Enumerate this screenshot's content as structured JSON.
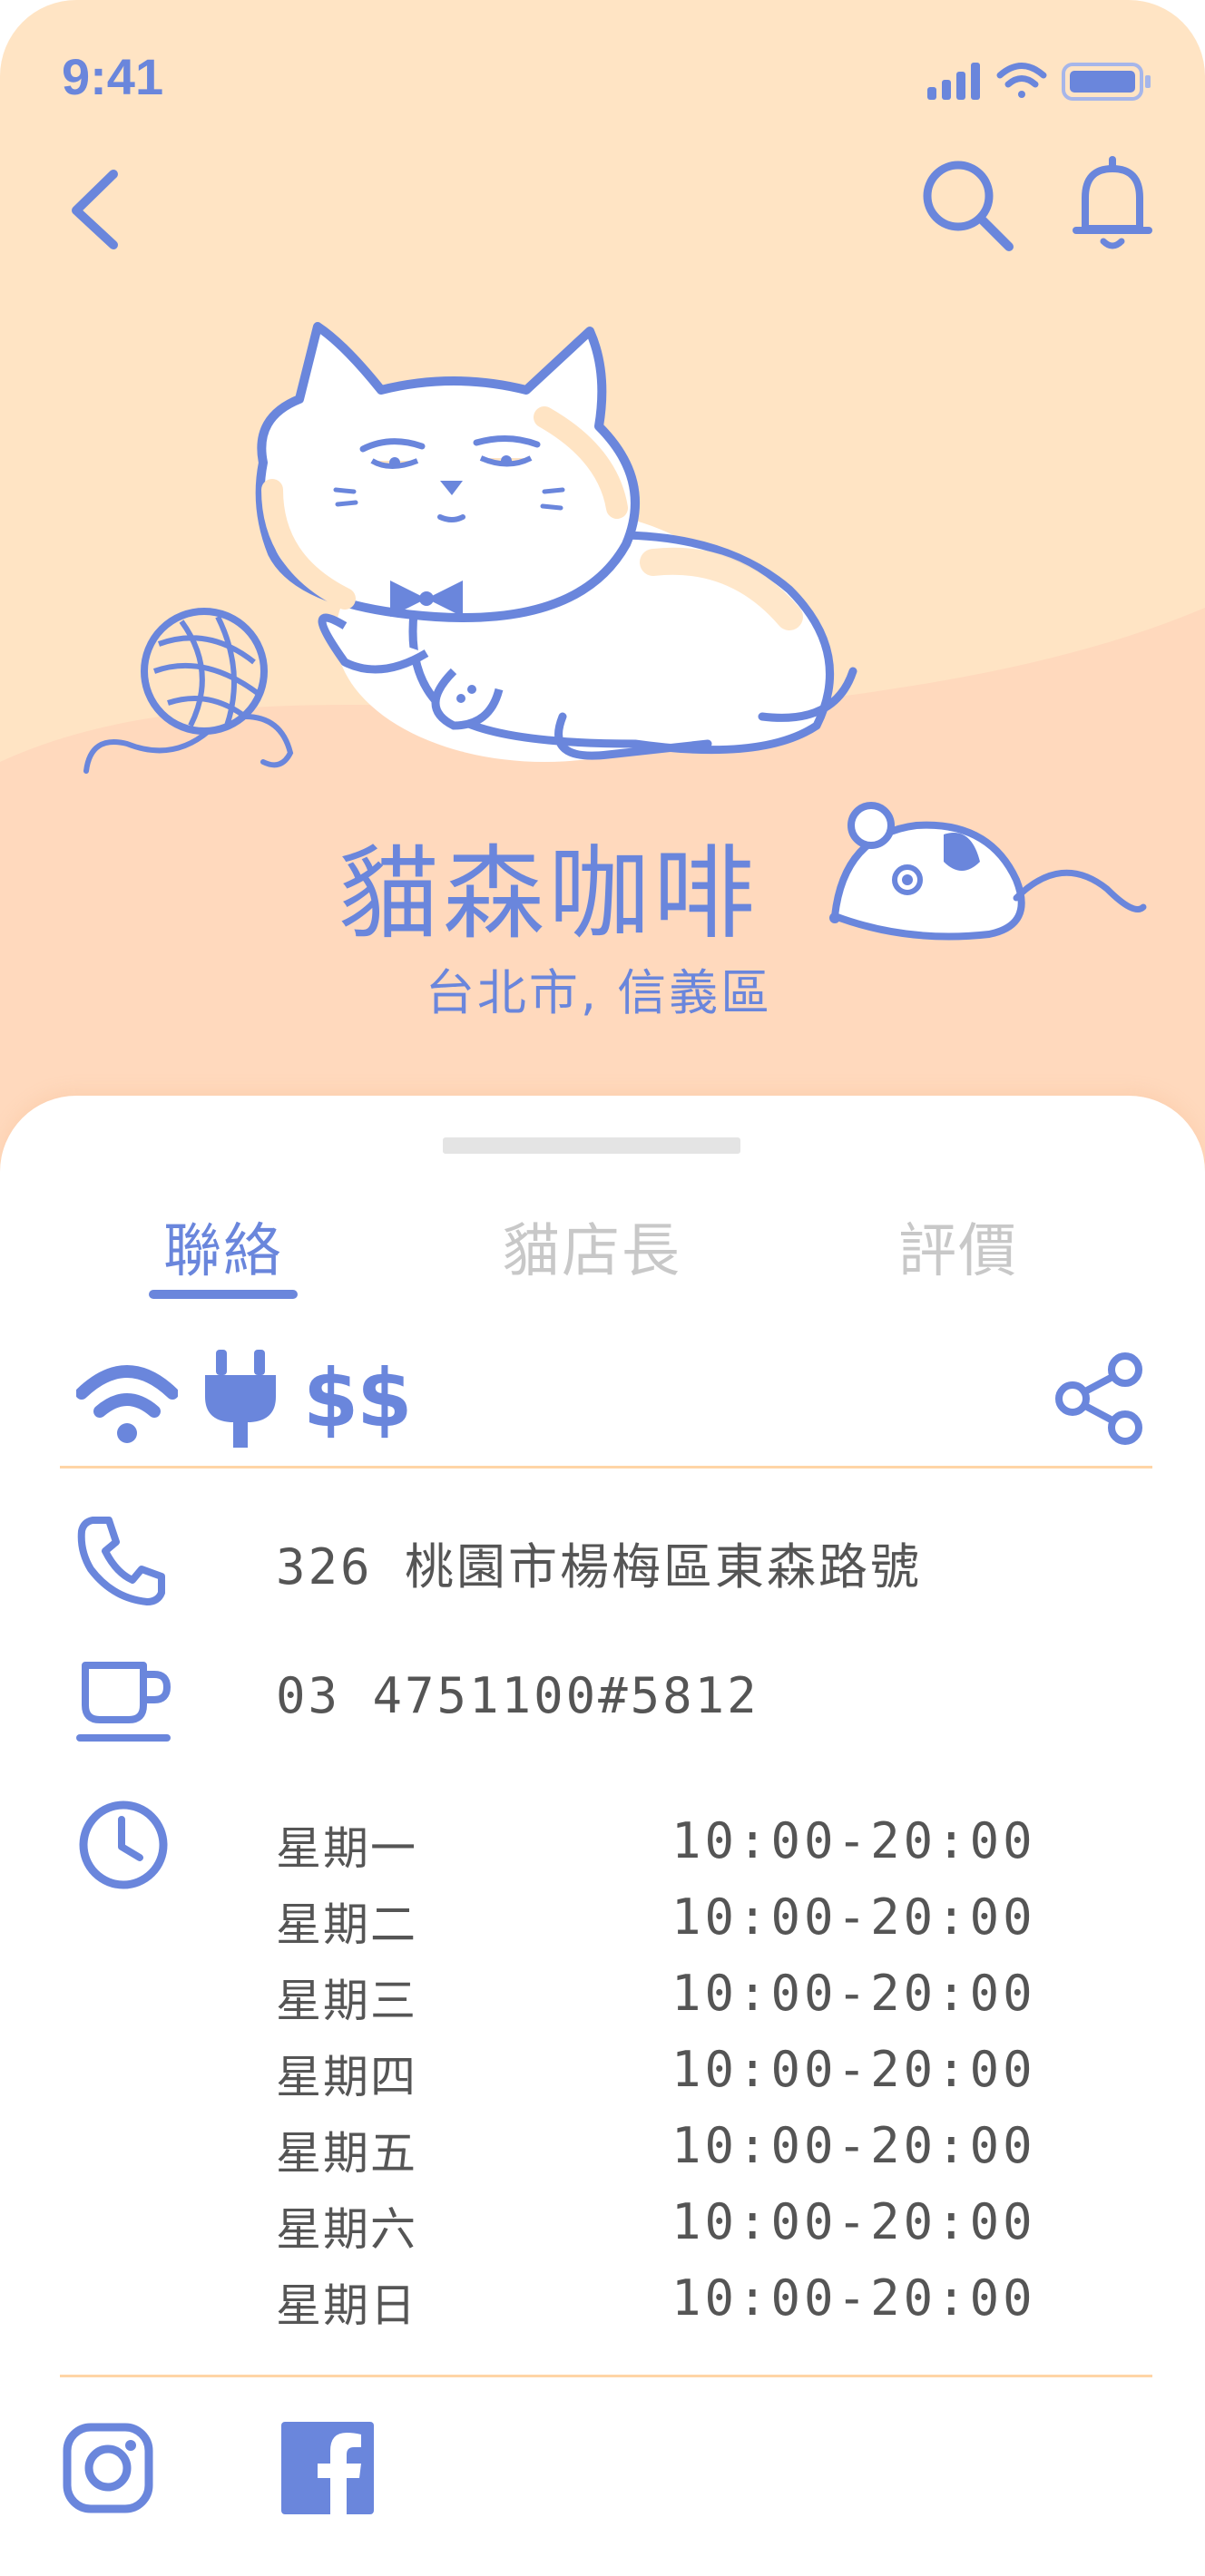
{
  "status_bar": {
    "time": "9:41",
    "icons": [
      "signal-icon",
      "wifi-icon",
      "battery-icon"
    ]
  },
  "nav": {
    "icons": [
      "back-arrow-icon",
      "search-icon",
      "bell-icon"
    ]
  },
  "hero": {
    "shop_name": "貓森咖啡",
    "location": "台北市, 信義區",
    "illustration": [
      "cat-illustration",
      "yarn-ball-illustration",
      "mouse-illustration"
    ]
  },
  "tabs": [
    {
      "label": "聯絡",
      "active": true
    },
    {
      "label": "貓店長",
      "active": false
    },
    {
      "label": "評價",
      "active": false
    }
  ],
  "amenities": {
    "icons": [
      "wifi-icon",
      "power-plug-icon"
    ],
    "price_level": "$$",
    "share_icon": "share-icon"
  },
  "contact": {
    "address": "326 桃園市楊梅區東森路號",
    "phone": "03 4751100#5812",
    "icons": [
      "phone-icon",
      "coffee-cup-icon",
      "clock-icon"
    ]
  },
  "hours": [
    {
      "day": "星期一",
      "time": "10:00-20:00"
    },
    {
      "day": "星期二",
      "time": "10:00-20:00"
    },
    {
      "day": "星期三",
      "time": "10:00-20:00"
    },
    {
      "day": "星期四",
      "time": "10:00-20:00"
    },
    {
      "day": "星期五",
      "time": "10:00-20:00"
    },
    {
      "day": "星期六",
      "time": "10:00-20:00"
    },
    {
      "day": "星期日",
      "time": "10:00-20:00"
    }
  ],
  "social": {
    "icons": [
      "instagram-icon",
      "facebook-icon"
    ]
  },
  "colors": {
    "accent": "#6a86dc",
    "hero_background": "#ffe4c4",
    "hero_wave": "#ffd9bd",
    "divider": "#ffd5a6",
    "body_text": "#555555",
    "inactive_tab": "#c8c8c8"
  }
}
